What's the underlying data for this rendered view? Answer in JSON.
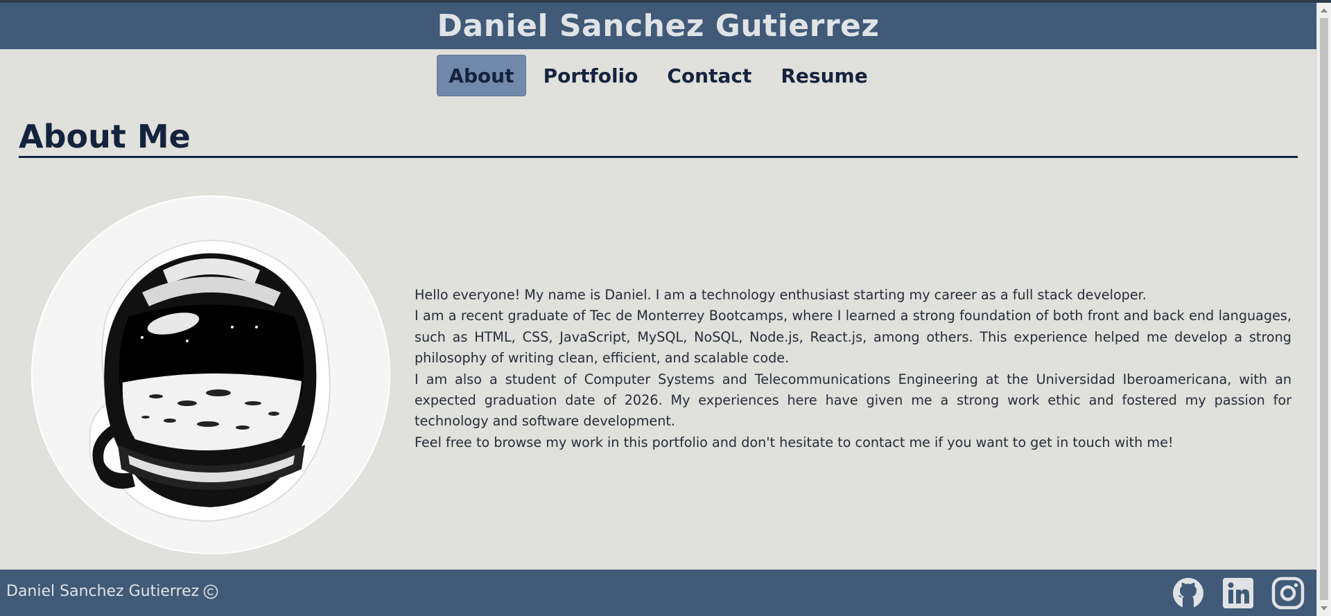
{
  "header": {
    "title": "Daniel Sanchez Gutierrez"
  },
  "nav": {
    "items": [
      {
        "label": "About",
        "active": true
      },
      {
        "label": "Portfolio",
        "active": false
      },
      {
        "label": "Contact",
        "active": false
      },
      {
        "label": "Resume",
        "active": false
      }
    ]
  },
  "about": {
    "title": "About Me",
    "image_icon": "astronaut-helmet-icon",
    "paragraphs": [
      "Hello everyone! My name is Daniel. I am a technology enthusiast starting my career as a full stack developer.",
      "I am a recent graduate of Tec de Monterrey Bootcamps, where I learned a strong foundation of both front and back end languages, such as HTML, CSS, JavaScript, MySQL, NoSQL, Node.js, React.js, among others. This experience helped me develop a strong philosophy of writing clean, efficient, and scalable code.",
      "I am also a student of Computer Systems and Telecommunications Engineering at the Universidad Iberoamericana, with an expected graduation date of 2026. My experiences here have given me a strong work ethic and fostered my passion for technology and software development.",
      "Feel free to browse my work in this portfolio and don't hesitate to contact me if you want to get in touch with me!"
    ]
  },
  "footer": {
    "text": "Daniel Sanchez Gutierrez",
    "copyright_icon": "copyright-icon",
    "social_icons": [
      "github-icon",
      "linkedin-icon",
      "instagram-icon"
    ]
  },
  "colors": {
    "header_bg": "#405a78",
    "page_bg": "#e0e0dc",
    "nav_active_bg": "#7189ab",
    "text_dark": "#14233d"
  }
}
